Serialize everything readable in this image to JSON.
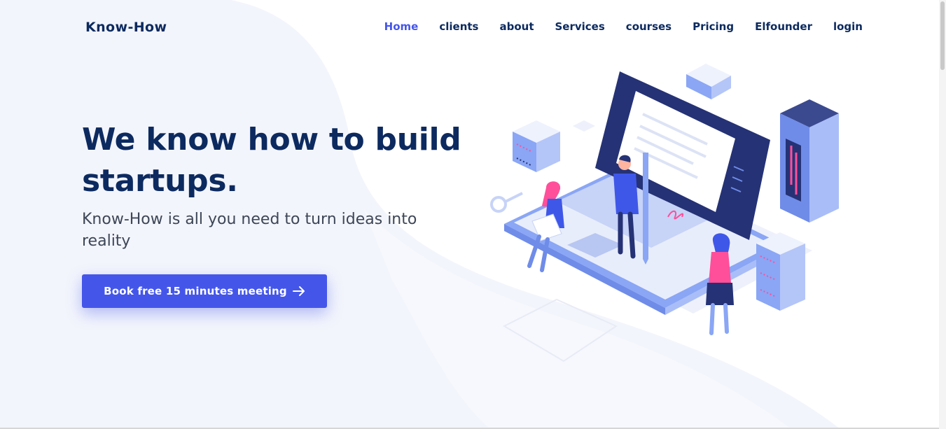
{
  "brand": {
    "name": "Know-How"
  },
  "nav": {
    "items": [
      {
        "label": "Home",
        "active": true
      },
      {
        "label": "clients"
      },
      {
        "label": "about"
      },
      {
        "label": "Services"
      },
      {
        "label": "courses"
      },
      {
        "label": "Pricing"
      },
      {
        "label": "Elfounder"
      },
      {
        "label": "login"
      }
    ]
  },
  "hero": {
    "title_line1": "We know how to build",
    "title_line2": "startups.",
    "subtitle": "Know-How is all you need to turn ideas into reality",
    "cta_label": "Book free 15 minutes meeting"
  },
  "icons": {
    "cta_arrow": "arrow-right-icon",
    "hero_art": "isometric-startup-illustration"
  },
  "colors": {
    "primary": "#4456ea",
    "navy": "#0c2a5f",
    "text": "#3d4657",
    "blob": "#f3f5fc",
    "accent_pink": "#ff4f9a",
    "illustration_blue": "#8aa6f5"
  }
}
